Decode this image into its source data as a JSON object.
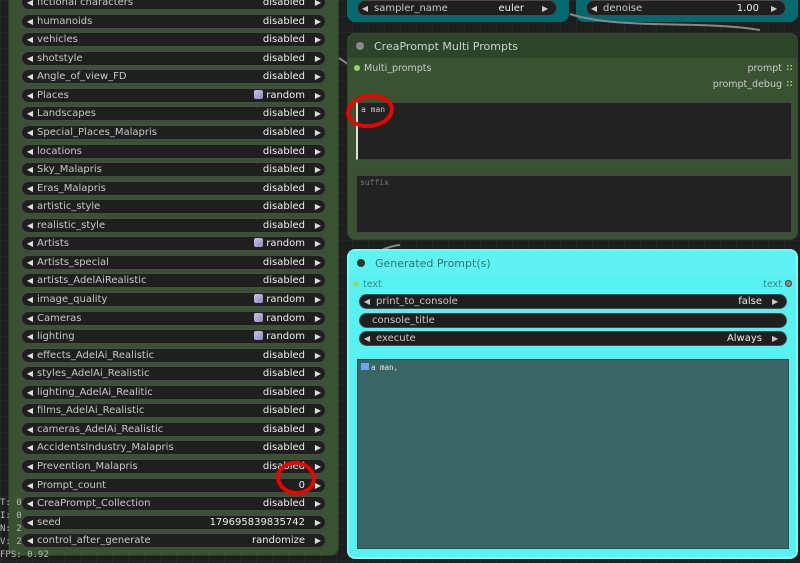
{
  "left_node": {
    "rows": [
      {
        "label": "fictional characters",
        "value": "disabled",
        "dice": false
      },
      {
        "label": "humanoids",
        "value": "disabled",
        "dice": false
      },
      {
        "label": "vehicles",
        "value": "disabled",
        "dice": false
      },
      {
        "label": "shotstyle",
        "value": "disabled",
        "dice": false
      },
      {
        "label": "Angle_of_view_FD",
        "value": "disabled",
        "dice": false
      },
      {
        "label": "Places",
        "value": "random",
        "dice": true
      },
      {
        "label": "Landscapes",
        "value": "disabled",
        "dice": false
      },
      {
        "label": "Special_Places_Malapris",
        "value": "disabled",
        "dice": false
      },
      {
        "label": "locations",
        "value": "disabled",
        "dice": false
      },
      {
        "label": "Sky_Malapris",
        "value": "disabled",
        "dice": false
      },
      {
        "label": "Eras_Malapris",
        "value": "disabled",
        "dice": false
      },
      {
        "label": "artistic_style",
        "value": "disabled",
        "dice": false
      },
      {
        "label": "realistic_style",
        "value": "disabled",
        "dice": false
      },
      {
        "label": "Artists",
        "value": "random",
        "dice": true
      },
      {
        "label": "Artists_special",
        "value": "disabled",
        "dice": false
      },
      {
        "label": "artists_AdelAiRealistic",
        "value": "disabled",
        "dice": false
      },
      {
        "label": "image_quality",
        "value": "random",
        "dice": true
      },
      {
        "label": "Cameras",
        "value": "random",
        "dice": true
      },
      {
        "label": "lighting",
        "value": "random",
        "dice": true
      },
      {
        "label": "effects_AdelAi_Realistic",
        "value": "disabled",
        "dice": false
      },
      {
        "label": "styles_AdelAi_Realistic",
        "value": "disabled",
        "dice": false
      },
      {
        "label": "lighting_AdelAi_Realitic",
        "value": "disabled",
        "dice": false
      },
      {
        "label": "films_AdelAi_Realistic",
        "value": "disabled",
        "dice": false
      },
      {
        "label": "cameras_AdelAi_Realistic",
        "value": "disabled",
        "dice": false
      },
      {
        "label": "AccidentsIndustry_Malapris",
        "value": "disabled",
        "dice": false
      },
      {
        "label": "Prevention_Malapris",
        "value": "disabled",
        "dice": false
      },
      {
        "label": "Prompt_count",
        "value": "0",
        "dice": false
      },
      {
        "label": "CreaPrompt_Collection",
        "value": "disabled",
        "dice": false
      },
      {
        "label": "seed",
        "value": "179695839835742",
        "dice": false
      },
      {
        "label": "control_after_generate",
        "value": "randomize",
        "dice": false
      }
    ]
  },
  "side_text": [
    "T: 0",
    "I: 0",
    "N: 2",
    "V: 2",
    "FPS: 0.92"
  ],
  "top_widgets": {
    "sampler": {
      "label": "sampler_name",
      "value": "euler"
    },
    "denoise": {
      "label": "denoise",
      "value": "1.00"
    }
  },
  "multi_prompts": {
    "title": "CreaPrompt Multi Prompts",
    "input": "Multi_prompts",
    "outputs": [
      "prompt",
      "prompt_debug"
    ],
    "prompt_text": "a man",
    "suffix_placeholder": "suffix"
  },
  "generated": {
    "title": "Generated Prompt(s)",
    "input": "text",
    "output": "text",
    "widgets": [
      {
        "label": "print_to_console",
        "value": "false",
        "arrows": true
      },
      {
        "label": "console_title",
        "value": "",
        "arrows": false
      },
      {
        "label": "execute",
        "value": "Always",
        "arrows": true
      }
    ],
    "output_text": "a man,"
  }
}
